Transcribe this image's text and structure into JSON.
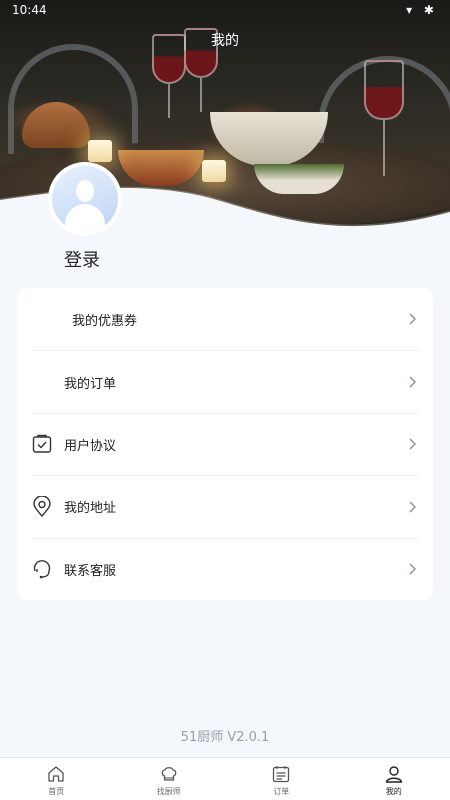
{
  "status_bar": {
    "time": "10:44",
    "icons": "▾ ✱"
  },
  "header": {
    "title": "我的"
  },
  "profile": {
    "login_label": "登录"
  },
  "menu": {
    "items": [
      {
        "label": "我的优惠券",
        "icon": "coupon-icon"
      },
      {
        "label": "我的订单",
        "icon": "order-icon"
      },
      {
        "label": "用户协议",
        "icon": "agreement-icon"
      },
      {
        "label": "我的地址",
        "icon": "location-icon"
      },
      {
        "label": "联系客服",
        "icon": "customer-service-icon"
      }
    ]
  },
  "footer": {
    "version": "51厨师 V2.0.1"
  },
  "tabbar": {
    "tabs": [
      {
        "label": "首页",
        "icon": "home-icon",
        "active": false
      },
      {
        "label": "找厨师",
        "icon": "chef-hat-icon",
        "active": false
      },
      {
        "label": "订单",
        "icon": "calendar-icon",
        "active": false
      },
      {
        "label": "我的",
        "icon": "person-icon",
        "active": true
      }
    ]
  },
  "colors": {
    "page_bg": "#f4f7fb",
    "card_bg": "#ffffff",
    "text_primary": "#222222",
    "text_muted": "#9aa0a8",
    "divider": "#eef0f3"
  }
}
